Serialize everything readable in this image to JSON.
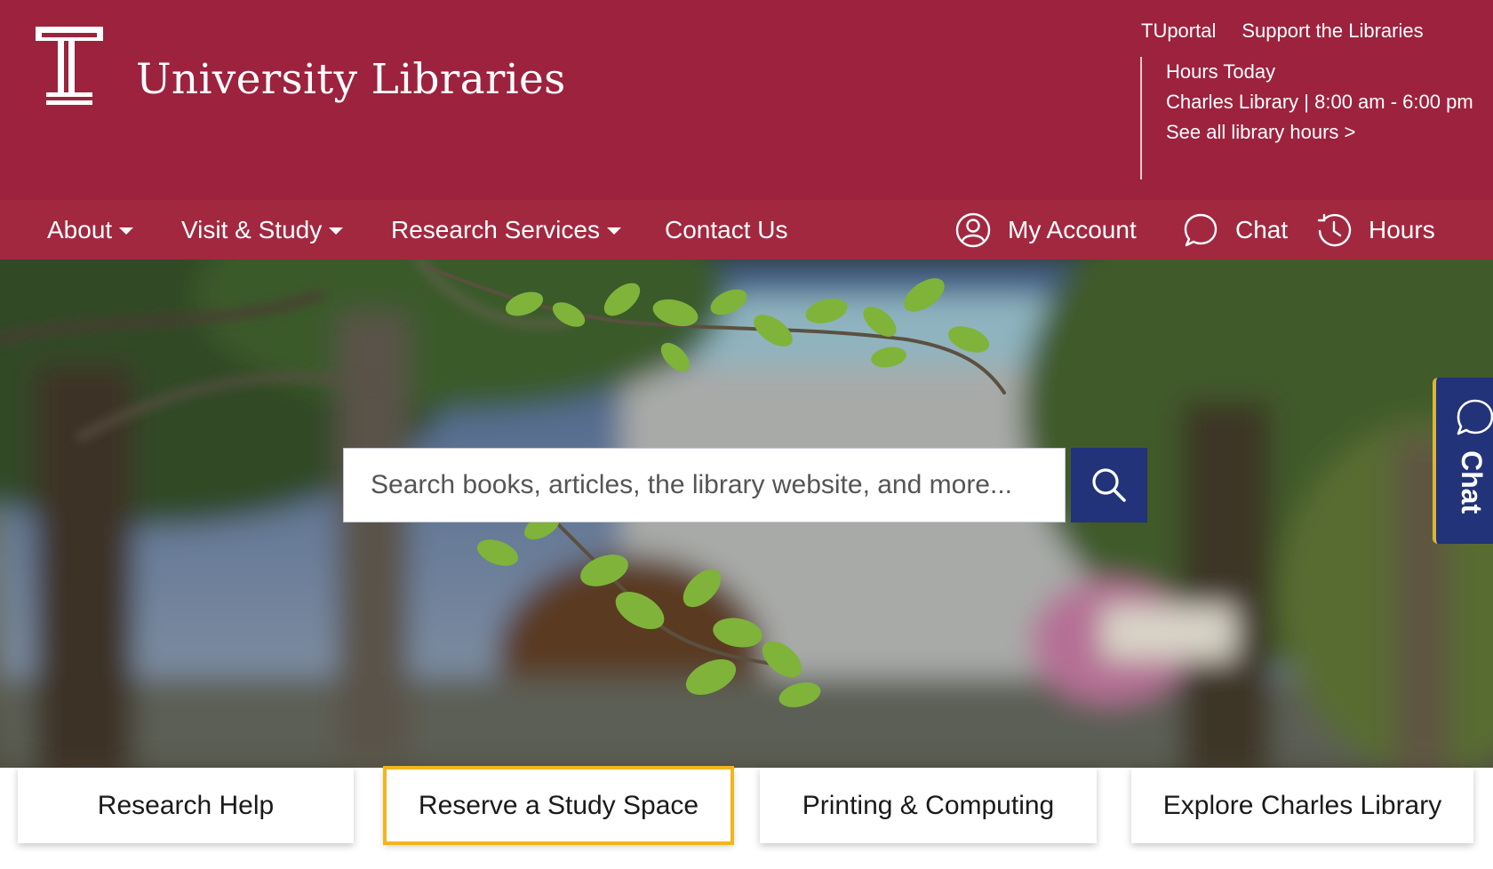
{
  "header": {
    "site_title": "University Libraries",
    "utility_links": [
      "TUportal",
      "Support the Libraries"
    ],
    "hours_heading": "Hours Today",
    "hours_detail": "Charles Library | 8:00 am - 6:00 pm",
    "hours_link": "See all library hours >"
  },
  "nav": {
    "items": [
      "About",
      "Visit & Study",
      "Research Services",
      "Contact Us"
    ],
    "account_label": "My Account",
    "chat_label": "Chat",
    "hours_label": "Hours"
  },
  "search": {
    "placeholder": "Search books, articles, the library website, and more..."
  },
  "chat_tab": {
    "label": "Chat"
  },
  "quick_links": [
    "Research Help",
    "Reserve a Study Space",
    "Printing & Computing",
    "Explore Charles Library"
  ],
  "colors": {
    "brand_cherry": "#9d223e",
    "nav_cherry": "#a22840",
    "accent_navy": "#22337a",
    "focus_gold": "#f2b51e"
  }
}
